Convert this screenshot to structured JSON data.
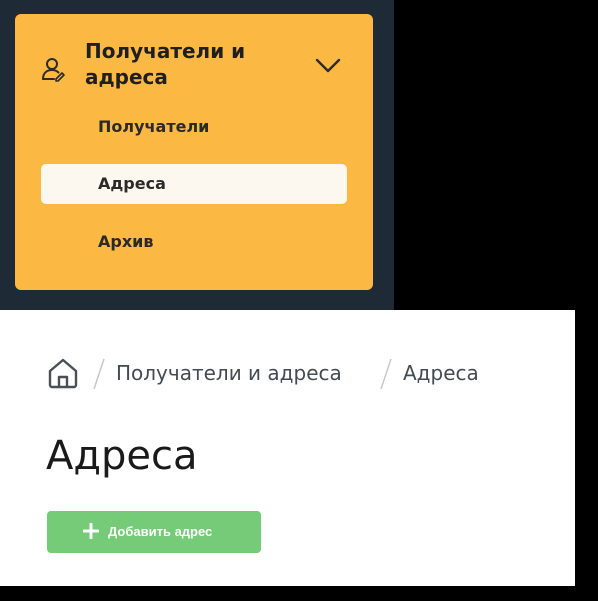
{
  "sidebar": {
    "group_title": "Получатели и адреса",
    "group_icon": "user-icon",
    "expand_icon": "chevron-down-icon",
    "items": [
      {
        "label": "Получатели",
        "active": false
      },
      {
        "label": "Адреса",
        "active": true
      },
      {
        "label": "Архив",
        "active": false
      }
    ],
    "colors": {
      "panel": "#1e2a36",
      "card": "#fbb843",
      "active_item": "#fdf8ef"
    }
  },
  "breadcrumb": {
    "home_icon": "home-icon",
    "items": [
      "Получатели и адреса",
      "Адреса"
    ]
  },
  "page": {
    "title": "Адреса",
    "add_button_label": "Добавить адрес",
    "add_button_icon": "plus-icon",
    "add_button_color": "#76cb78"
  }
}
